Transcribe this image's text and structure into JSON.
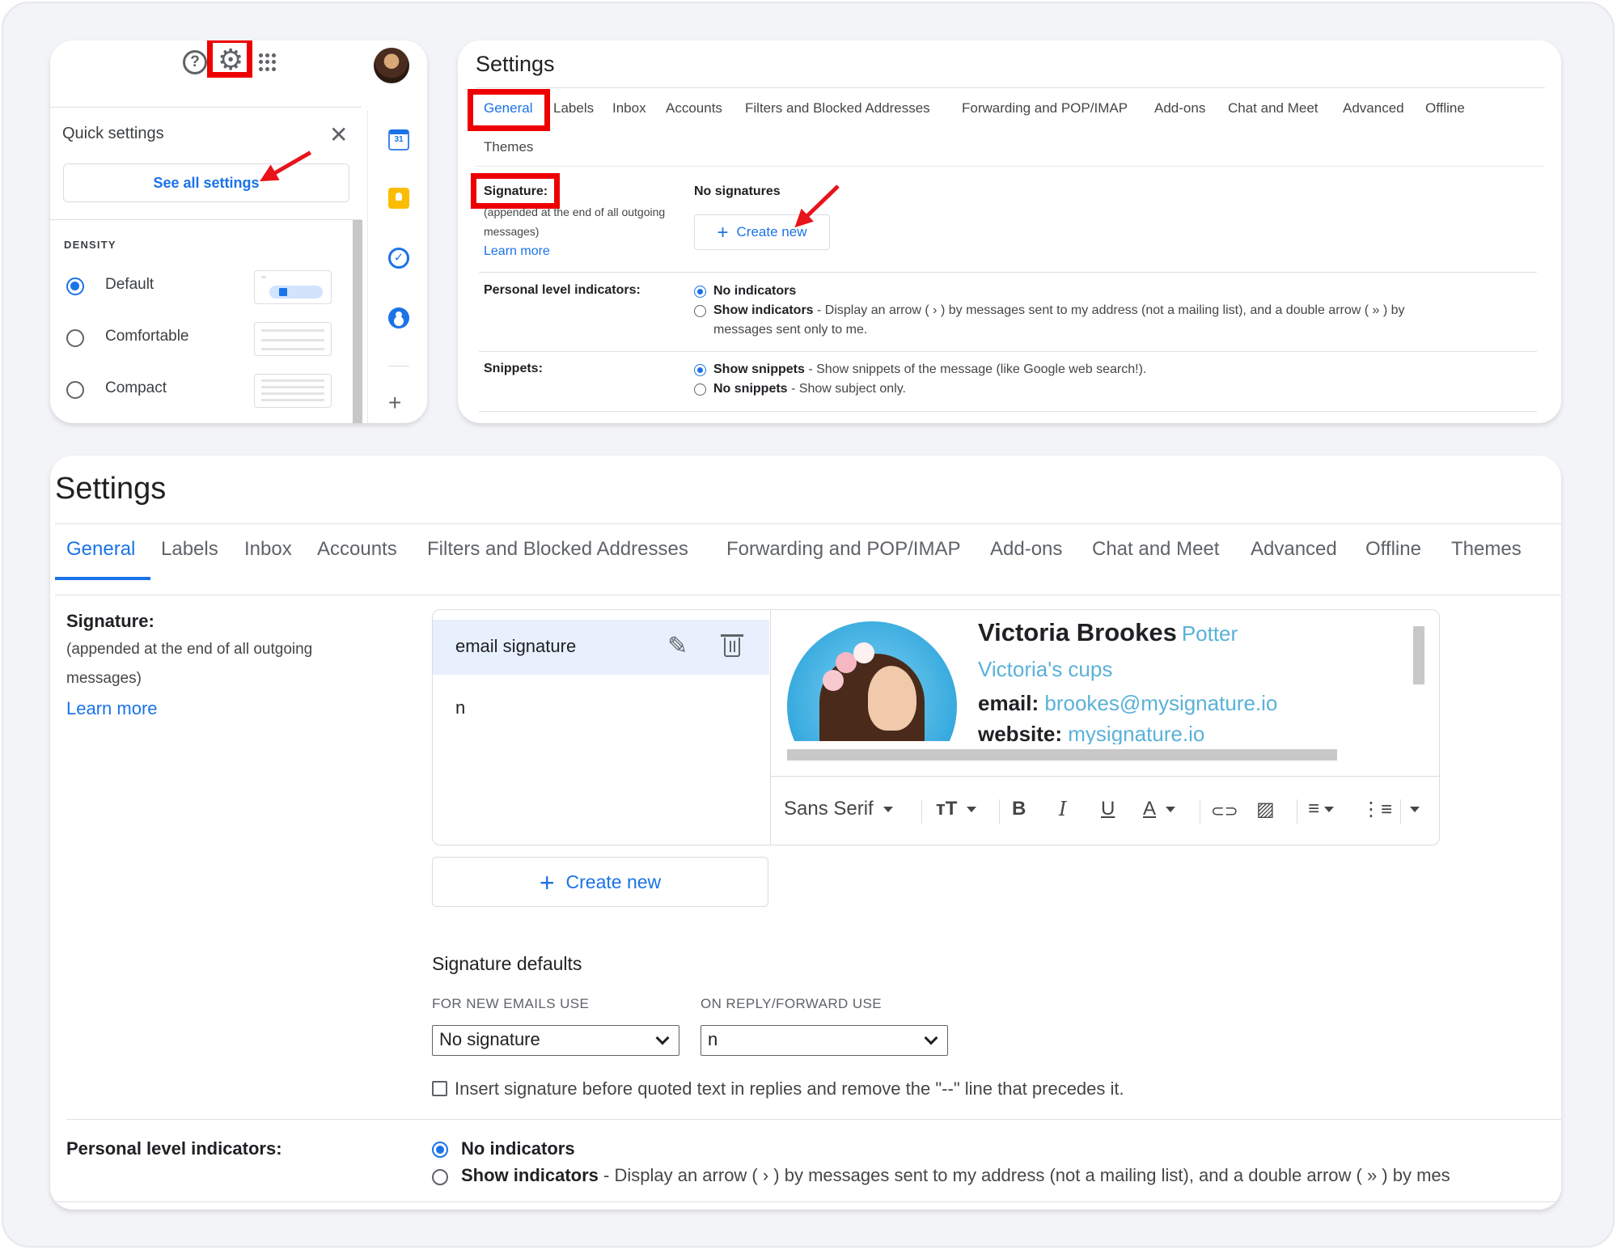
{
  "quick_settings": {
    "title": "Quick settings",
    "close_glyph": "✕",
    "see_all": "See all settings",
    "density_label": "DENSITY",
    "options": [
      {
        "label": "Default",
        "selected": true
      },
      {
        "label": "Comfortable",
        "selected": false
      },
      {
        "label": "Compact",
        "selected": false
      }
    ],
    "help_glyph": "?",
    "gear_glyph": "⚙",
    "calendar_day": "31",
    "tasks_glyph": "✓",
    "add_glyph": "+"
  },
  "settings_small": {
    "title": "Settings",
    "tabs": [
      "General",
      "Labels",
      "Inbox",
      "Accounts",
      "Filters and Blocked Addresses",
      "Forwarding and POP/IMAP",
      "Add-ons",
      "Chat and Meet",
      "Advanced",
      "Offline",
      "Themes"
    ],
    "signature": {
      "label": "Signature:",
      "note": "(appended at the end of all outgoing messages)",
      "learn_more": "Learn more",
      "status": "No signatures",
      "create_new": "Create new"
    },
    "personal": {
      "label": "Personal level indicators:",
      "opt1": "No indicators",
      "opt2_bold": "Show indicators",
      "opt2_desc": " - Display an arrow ( › ) by messages sent to my address (not a mailing list), and a double arrow ( » ) by",
      "opt2_desc2": "messages sent only to me."
    },
    "snippets": {
      "label": "Snippets:",
      "opt1_bold": "Show snippets",
      "opt1_desc": " - Show snippets of the message (like Google web search!).",
      "opt2_bold": "No snippets",
      "opt2_desc": " - Show subject only."
    }
  },
  "settings_large": {
    "title": "Settings",
    "tabs": [
      "General",
      "Labels",
      "Inbox",
      "Accounts",
      "Filters and Blocked Addresses",
      "Forwarding and POP/IMAP",
      "Add-ons",
      "Chat and Meet",
      "Advanced",
      "Offline",
      "Themes"
    ],
    "signature": {
      "label": "Signature:",
      "note_line1": "(appended at the end of all outgoing",
      "note_line2": "messages)",
      "learn_more": "Learn more",
      "list": [
        "email signature",
        "n"
      ],
      "card": {
        "name": "Victoria Brookes",
        "role": "Potter",
        "company": "Victoria's cups",
        "email_label": "email:",
        "email": "brookes@mysignature.io",
        "website_label": "website:",
        "website": "mysignature.io"
      },
      "toolbar": {
        "font": "Sans Serif",
        "size_glyph": "тT",
        "bold": "B",
        "italic": "I",
        "underline": "U",
        "color": "A",
        "link_glyph": "⊂⊃",
        "image_glyph": "▨",
        "align_glyph": "≡",
        "list_glyph": "⋮≡"
      },
      "pencil_glyph": "✎",
      "create_new": "Create new",
      "plus_glyph": "+"
    },
    "defaults": {
      "title": "Signature defaults",
      "new_label": "FOR NEW EMAILS USE",
      "reply_label": "ON REPLY/FORWARD USE",
      "new_value": "No signature",
      "reply_value": "n",
      "checkbox_label": "Insert signature before quoted text in replies and remove the \"--\" line that precedes it."
    },
    "personal": {
      "label": "Personal level indicators:",
      "opt1": "No indicators",
      "opt2_bold": "Show indicators",
      "opt2_desc": " - Display an arrow ( › ) by messages sent to my address (not a mailing list), and a double arrow ( » ) by mes"
    }
  },
  "colors": {
    "accent": "#1a73e8",
    "highlight": "#ee0000",
    "signature_blue": "#5ab1d8"
  }
}
